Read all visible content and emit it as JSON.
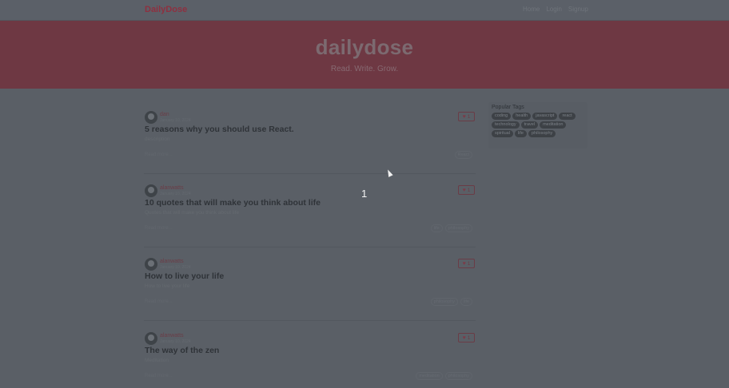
{
  "navbar": {
    "brand": "DailyDose",
    "links": [
      "Home",
      "Login",
      "Signup"
    ]
  },
  "banner": {
    "title": "dailydose",
    "tagline": "Read. Write. Grow."
  },
  "articles": [
    {
      "author": "dan",
      "date": "January 10, 2024",
      "title": "5 reasons why you should use React.",
      "description": "description",
      "read_more": "Read more...",
      "tags": [
        "React"
      ],
      "likes": "1"
    },
    {
      "author": "alanwatts",
      "date": "January 10, 2024",
      "title": "10 quotes that will make you think about life",
      "description": "Quotes that will make you think about life",
      "read_more": "Read more...",
      "tags": [
        "life",
        "philosophy"
      ],
      "likes": "1"
    },
    {
      "author": "alanwatts",
      "date": "January 10, 2024",
      "title": "How to live your life",
      "description": "How to live your life",
      "read_more": "Read more...",
      "tags": [
        "philosophy",
        "life"
      ],
      "likes": "1"
    },
    {
      "author": "alanwatts",
      "date": "January 10, 2024",
      "title": "The way of the zen",
      "description": "Meditation",
      "read_more": "Read more...",
      "tags": [
        "meditation",
        "philosophy"
      ],
      "likes": "1"
    }
  ],
  "sidebar": {
    "title": "Popular Tags",
    "tags": [
      "coding",
      "health",
      "javascript",
      "react",
      "technology",
      "travel",
      "meditation",
      "spiritual",
      "life",
      "philosophy"
    ]
  },
  "overlay": {
    "step_label": "1"
  },
  "colors": {
    "brand": "#8e3040",
    "banner": "#6e3843",
    "background": "#5a5f66"
  }
}
